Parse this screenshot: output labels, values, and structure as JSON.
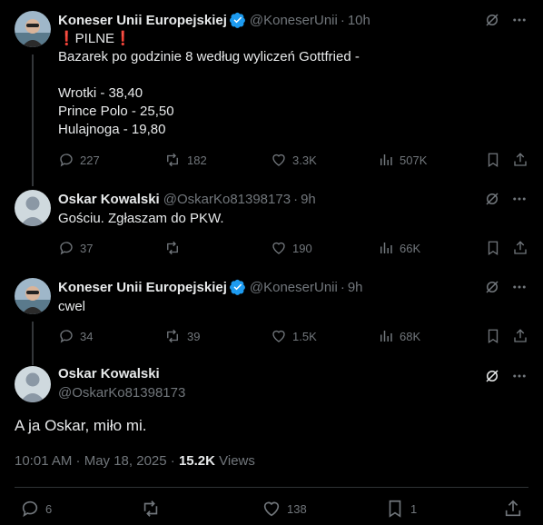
{
  "tweets": [
    {
      "name": "Koneser Unii Europejskiej",
      "verified": true,
      "handle": "@KoneserUnii",
      "time": "10h",
      "text": "❗️PILNE❗️\nBazarek po godzinie 8 według wyliczeń Gottfried -\n\nWrotki - 38,40\nPrince Polo - 25,50\nHulajnoga - 19,80",
      "replies": "227",
      "reposts": "182",
      "likes": "3.3K",
      "views": "507K"
    },
    {
      "name": "Oskar Kowalski",
      "verified": false,
      "handle": "@OskarKo81398173",
      "time": "9h",
      "text": "Gościu. Zgłaszam do PKW.",
      "replies": "37",
      "reposts": "",
      "likes": "190",
      "views": "66K"
    },
    {
      "name": "Koneser Unii Europejskiej",
      "verified": true,
      "handle": "@KoneserUnii",
      "time": "9h",
      "text": "cwel",
      "replies": "34",
      "reposts": "39",
      "likes": "1.5K",
      "views": "68K"
    }
  ],
  "main": {
    "name": "Oskar Kowalski",
    "handle": "@OskarKo81398173",
    "text": "A ja Oskar, miło mi.",
    "timestamp": "10:01 AM · May 18, 2025 · ",
    "views_count": "15.2K",
    "views_label": " Views",
    "replies": "6",
    "reposts": "",
    "likes": "138",
    "bookmarks": "1"
  },
  "icons": [
    "grok-icon",
    "more-icon",
    "reply-icon",
    "repost-icon",
    "like-icon",
    "views-icon",
    "bookmark-icon",
    "share-icon",
    "verified-badge-icon"
  ],
  "colors": {
    "background": "#000000",
    "text": "#e7e9ea",
    "muted": "#71767b",
    "verified": "#1d9bf0",
    "divider": "#2f3336"
  },
  "separator": "·"
}
